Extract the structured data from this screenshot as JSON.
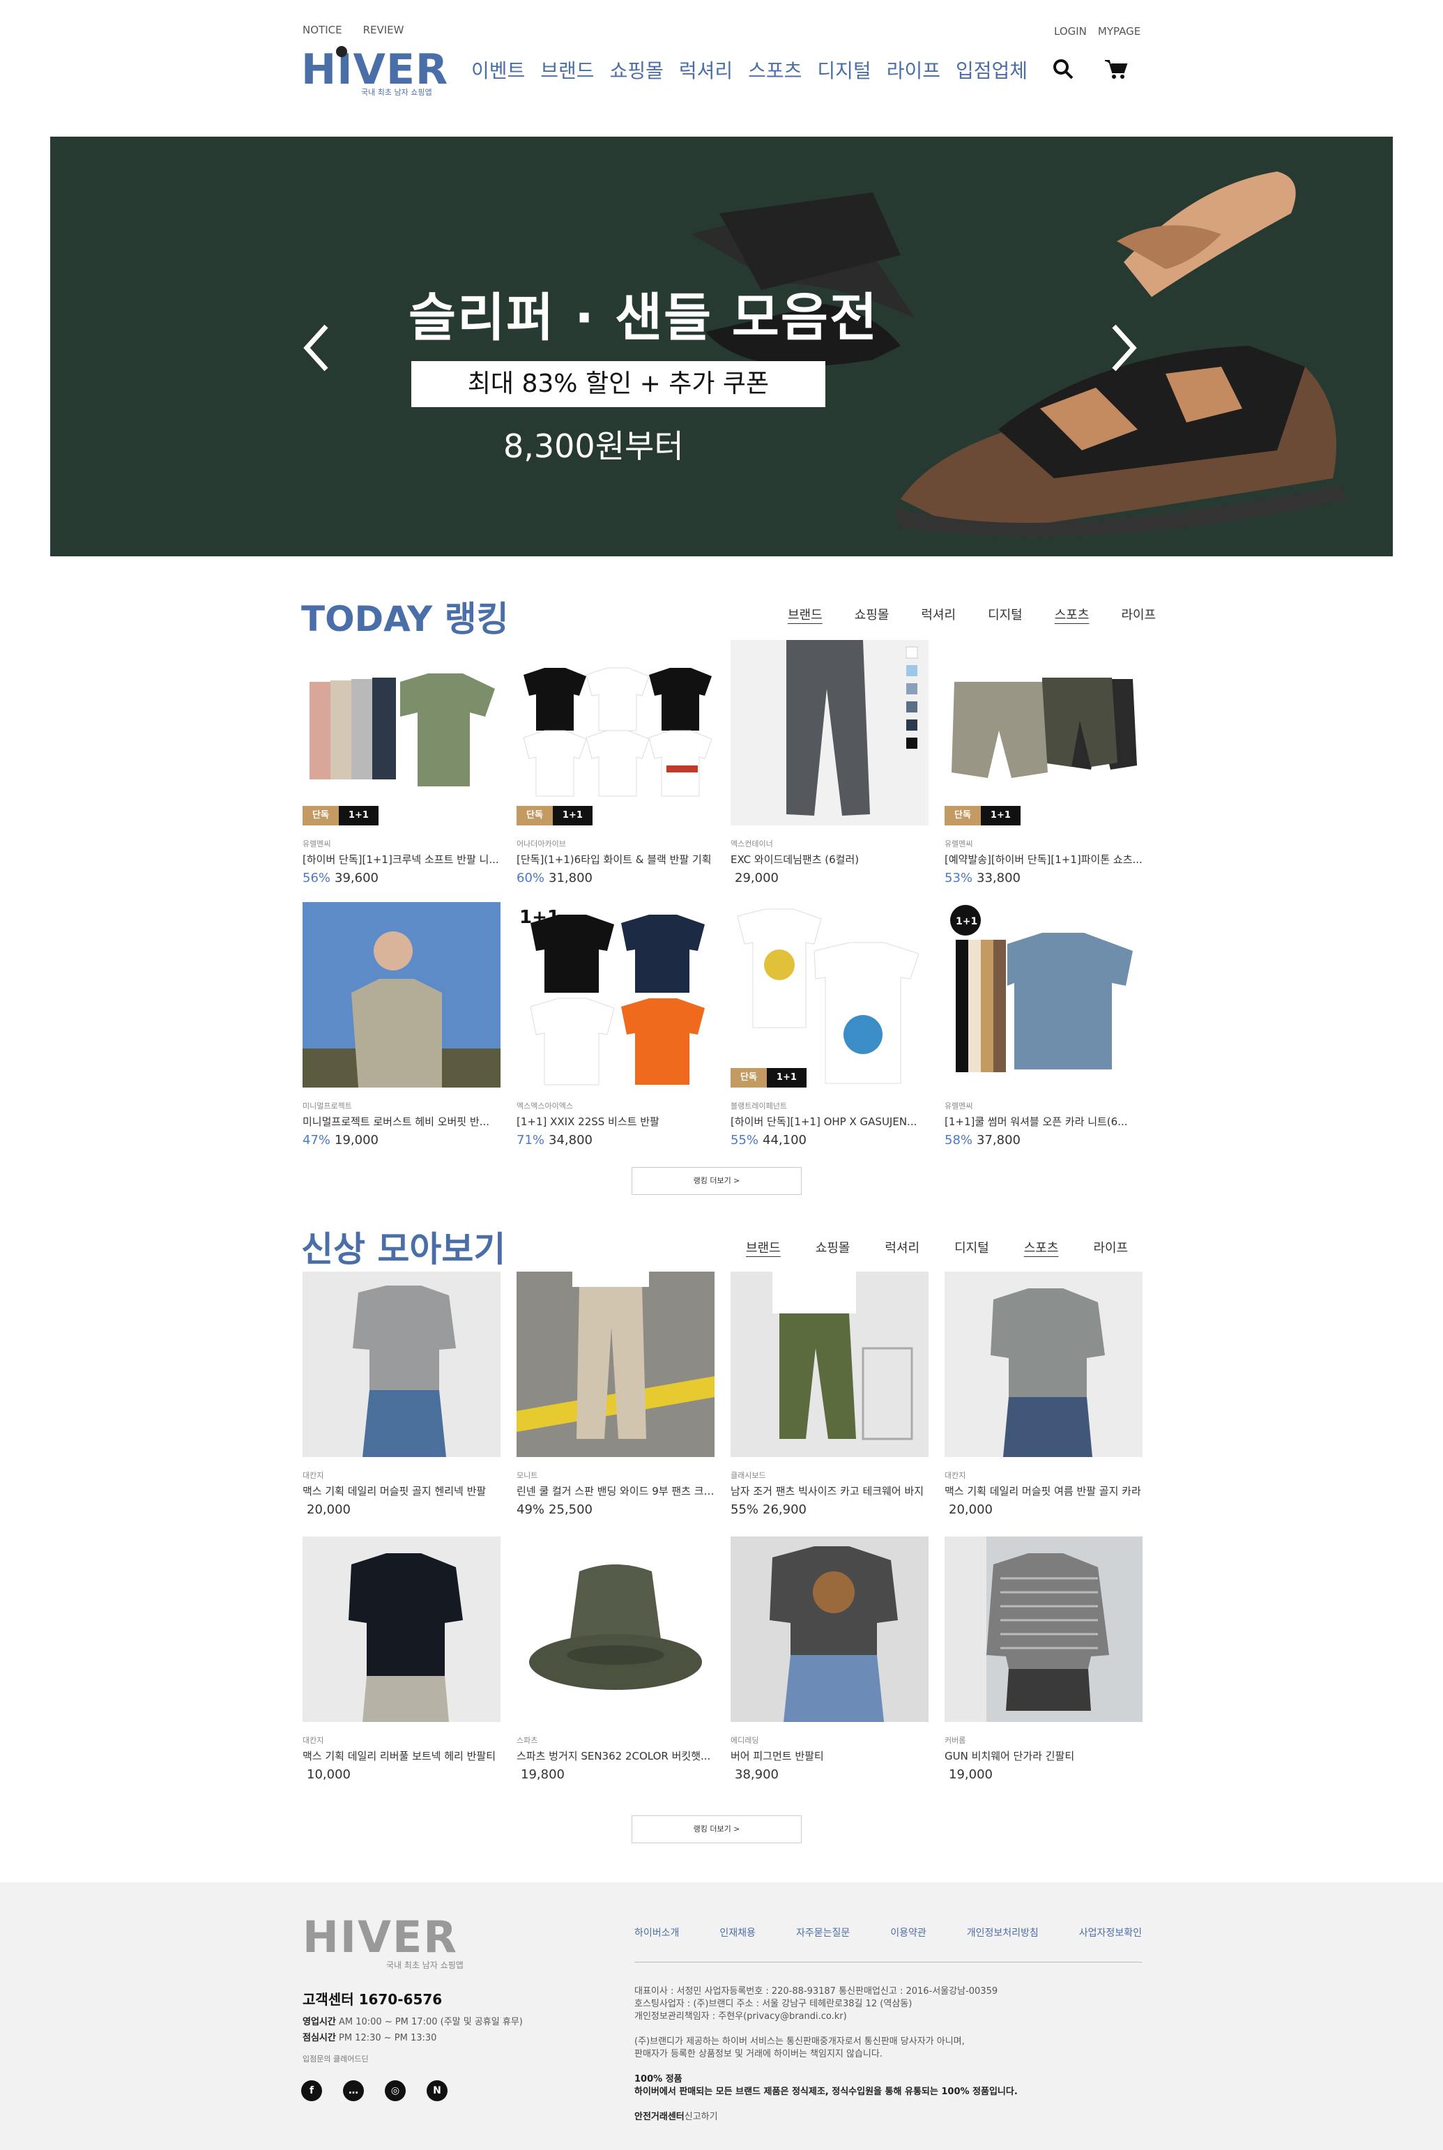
{
  "header": {
    "top_left": [
      "NOTICE",
      "REVIEW"
    ],
    "top_right": [
      "LOGIN",
      "MYPAGE"
    ],
    "logo_text": "HIVER",
    "logo_sub": "국내 최초 남자 쇼핑앱",
    "nav": [
      "이벤트",
      "브랜드",
      "쇼핑몰",
      "럭셔리",
      "스포츠",
      "디지털",
      "라이프",
      "입점업체"
    ],
    "icons": [
      "search-icon",
      "cart-icon"
    ]
  },
  "banner": {
    "title": "슬리퍼 · 샌들 모음전",
    "pill": "최대 83% 할인 + 추가 쿠폰",
    "from": "8,300원부터",
    "bg_color": "#263a31"
  },
  "ranking": {
    "title": "TODAY 랭킹",
    "tabs": [
      "브랜드",
      "쇼핑몰",
      "럭셔리",
      "디지털",
      "스포츠",
      "라이프"
    ],
    "more": "랭킹 더보기  >",
    "items": [
      {
        "brand": "유렐멘씨",
        "name": "[하이버 단독][1+1]크루넥 소프트 반팔 니...",
        "disc": "56%",
        "price": "39,600",
        "badge1": "단독",
        "badge2": "1+1"
      },
      {
        "brand": "어나더아카이브",
        "name": "[단독](1+1)6타입 화이트 & 블랙 반팔 기획",
        "disc": "60%",
        "price": "31,800",
        "badge1": "단독",
        "badge2": "1+1"
      },
      {
        "brand": "엑스컨테이너",
        "name": "EXC 와이드데님팬츠 (6컬러)",
        "disc": "",
        "price": "29,000",
        "badge1": "",
        "badge2": ""
      },
      {
        "brand": "유렐멘씨",
        "name": "[예약발송][하이버 단독][1+1]파이톤 쇼츠...",
        "disc": "53%",
        "price": "33,800",
        "badge1": "단독",
        "badge2": "1+1"
      },
      {
        "brand": "미니멀프로젝트",
        "name": "미니멀프로젝트 로버스트 헤비 오버핏 반...",
        "disc": "47%",
        "price": "19,000",
        "badge1": "",
        "badge2": ""
      },
      {
        "brand": "엑스엑스아이엑스",
        "name": "[1+1] XXIX 22SS 비스트 반팔",
        "disc": "71%",
        "price": "34,800",
        "badge1": "",
        "badge2": ""
      },
      {
        "brand": "블랭트레이페넌트",
        "name": "[하이버 단독][1+1] OHP X GASUJEN...",
        "disc": "55%",
        "price": "44,100",
        "badge1": "단독",
        "badge2": "1+1"
      },
      {
        "brand": "유렐멘씨",
        "name": "[1+1]쿨 썸머 워셔블 오픈 카라 니트(6...",
        "disc": "58%",
        "price": "37,800",
        "badge1": "",
        "badge2": ""
      }
    ]
  },
  "newitems": {
    "title": "신상 모아보기",
    "tabs": [
      "브랜드",
      "쇼핑몰",
      "럭셔리",
      "디지털",
      "스포츠",
      "라이프"
    ],
    "more": "랭킹 더보기  >",
    "items": [
      {
        "brand": "대칸지",
        "name": "맥스 기획 데일리 머슬핏 골지 헨리넥 반팔",
        "disc": "",
        "price": "20,000"
      },
      {
        "brand": "모니트",
        "name": "린넨 쿨 컬거 스판 밴딩 와이드 9부 팬츠 크롭...",
        "disc": "49%",
        "price": "25,500"
      },
      {
        "brand": "클래시보드",
        "name": "남자 조거 팬츠 빅사이즈 카고 테크웨어 바지",
        "disc": "55%",
        "price": "26,900"
      },
      {
        "brand": "대칸지",
        "name": "맥스 기획 데일리 머슬핏 여름 반팔 골지 카라",
        "disc": "",
        "price": "20,000"
      },
      {
        "brand": "대칸지",
        "name": "맥스 기획 데일리 리버풀 보트넥 헤리 반팔티",
        "disc": "",
        "price": "10,000"
      },
      {
        "brand": "스파츠",
        "name": "스파츠 벙거지 SEN362 2COLOR 버킷햇...",
        "disc": "",
        "price": "19,800"
      },
      {
        "brand": "에디레딩",
        "name": "버어 피그먼트 반팔티",
        "disc": "",
        "price": "38,900"
      },
      {
        "brand": "커버롬",
        "name": "GUN 비치웨어 단가라 긴팔티",
        "disc": "",
        "price": "19,000"
      }
    ]
  },
  "footer": {
    "logo_text": "HIVER",
    "logo_sub": "국내 최초 남자 쇼핑앱",
    "links": [
      "하이버소개",
      "인재채용",
      "자주묻는질문",
      "이용약관",
      "개인정보처리방침",
      "사업자정보확인"
    ],
    "cs_title": "고객센터 1670-6576",
    "hours1_label": "영업시간",
    "hours1": "AM 10:00 ~ PM 17:00 (주말 및 공휴일 휴무)",
    "hours2_label": "점심시간",
    "hours2": "PM 12:30 ~ PM 13:30",
    "partner": "입점문의 클레어드딘",
    "info1": "대표이사 : 서정민  사업자등록번호 : 220-88-93187  통신판매업신고 : 2016-서울강남-00359",
    "info2": "호스팅사업자 : (주)브랜디  주소 : 서울 강남구 테헤란로38길 12 (역삼동)",
    "info3": "개인정보관리책임자 : 주현우(privacy@brandi.co.kr)",
    "info4": "(주)브랜디가 제공하는 하이버 서비스는 통신판매중개자로서 통신판매 당사자가 아니며,",
    "info5": "판매자가 등록한 상품정보 및 거래에 하이버는 책임지지 않습니다.",
    "info6": "100% 정품",
    "info7": "하이버에서 판매되는 모든 브랜드 제품은 정식제조, 정식수입원을 통해 유통되는 100% 정품입니다.",
    "info8": "안전거래센터",
    "info8b": "신고하기",
    "social": [
      "facebook-icon",
      "kakao-icon",
      "instagram-icon",
      "naver-icon"
    ]
  }
}
